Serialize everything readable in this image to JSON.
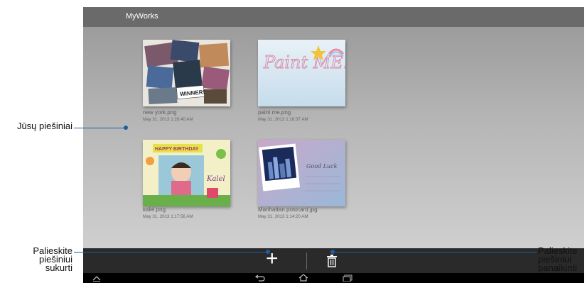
{
  "app": {
    "title": "MyWorks"
  },
  "drawings": [
    {
      "name": "new york.png",
      "date": "May 31, 2013 1:26:40 AM"
    },
    {
      "name": "paint me.png",
      "date": "May 31, 2013 1:16:37 AM"
    },
    {
      "name": "kalel.png",
      "date": "May 31, 2013 1:17:56 AM"
    },
    {
      "name": "Manhattan postcard.jpg",
      "date": "May 31, 2013 1:14:20 AM"
    }
  ],
  "thumb_texts": {
    "winner": "WINNER!",
    "paint_me": "Paint ME!",
    "birthday": "HAPPY BIRTHDAY",
    "kalel": "Kalel",
    "good_luck": "Good Luck"
  },
  "callouts": {
    "drawings": "Jūsų piešiniai",
    "create_1": "Palieskite",
    "create_2": "piešiniui",
    "create_3": "sukurti",
    "delete_1": "Palieskite",
    "delete_2": "piešiniui",
    "delete_3": "panaikinti"
  },
  "icons": {
    "add": "plus-icon",
    "delete": "trash-icon",
    "back": "back-icon",
    "home": "home-icon",
    "recent": "recent-apps-icon",
    "up": "chevron-up-icon"
  },
  "colors": {
    "leader": "#1f5e9e",
    "title_bar": "#6a6a6a",
    "action_bar": "#2a2a2a"
  }
}
